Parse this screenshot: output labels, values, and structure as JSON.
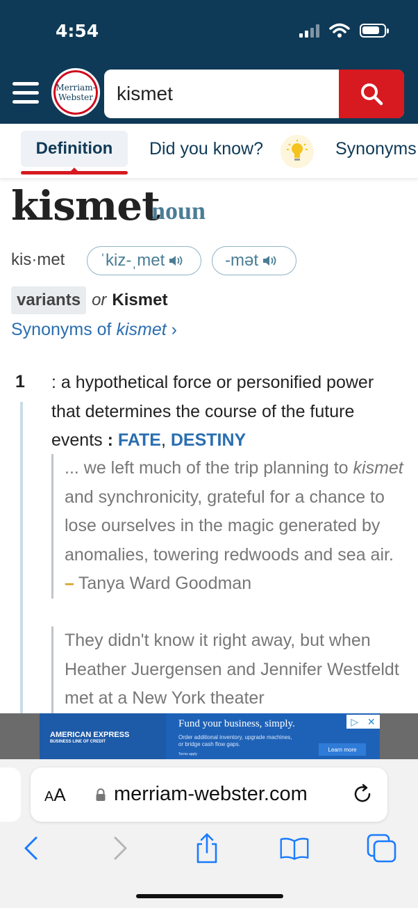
{
  "status": {
    "time": "4:54"
  },
  "header": {
    "logo_line1": "Merriam-",
    "logo_line2": "Webster",
    "search_value": "kismet"
  },
  "tabs": {
    "definition": "Definition",
    "did_you_know": "Did you know?",
    "synonyms": "Synonyms"
  },
  "entry": {
    "headword": "kismet",
    "part_of_speech": "noun",
    "syllables": "kis·met",
    "pronunciations": [
      "ˈkiz-ˌmet",
      "-mət"
    ],
    "variants_label": "variants",
    "or": "or",
    "variant": "Kismet",
    "synonyms_link_prefix": "Synonyms of ",
    "synonyms_link_word": "kismet",
    "synonyms_link_chevron": "›"
  },
  "sense": {
    "number": "1",
    "definition": ": a hypothetical force or personified power that determines the course of the future events",
    "separator": " : ",
    "xref1": "FATE",
    "comma": ", ",
    "xref2": "DESTINY"
  },
  "quotes": {
    "q1_pre": "... we left much of the trip planning to ",
    "q1_italic": "kismet",
    "q1_post": " and synchronicity, grateful for a chance to lose ourselves in the magic generated by anomalies, towering redwoods and sea air.",
    "q1_attribution": "Tanya Ward Goodman",
    "q2": "They didn't know it right away, but when Heather Juergensen and Jennifer Westfeldt met at a New York theater"
  },
  "ad": {
    "brand": "AMERICAN EXPRESS",
    "brand_sub": "BUSINESS LINE OF CREDIT",
    "headline": "Fund your business, simply.",
    "body": "Order additional inventory, upgrade machines, or bridge cash flow gaps.",
    "terms": "Terms apply",
    "cta": "Learn more"
  },
  "browser": {
    "aa_big": "A",
    "aa_small": "A",
    "url": "merriam-webster.com"
  },
  "colors": {
    "header_bg": "#0f3a57",
    "brand_red": "#d71920",
    "link_blue": "#2a6eb0",
    "pos_teal": "#4a7d95"
  }
}
